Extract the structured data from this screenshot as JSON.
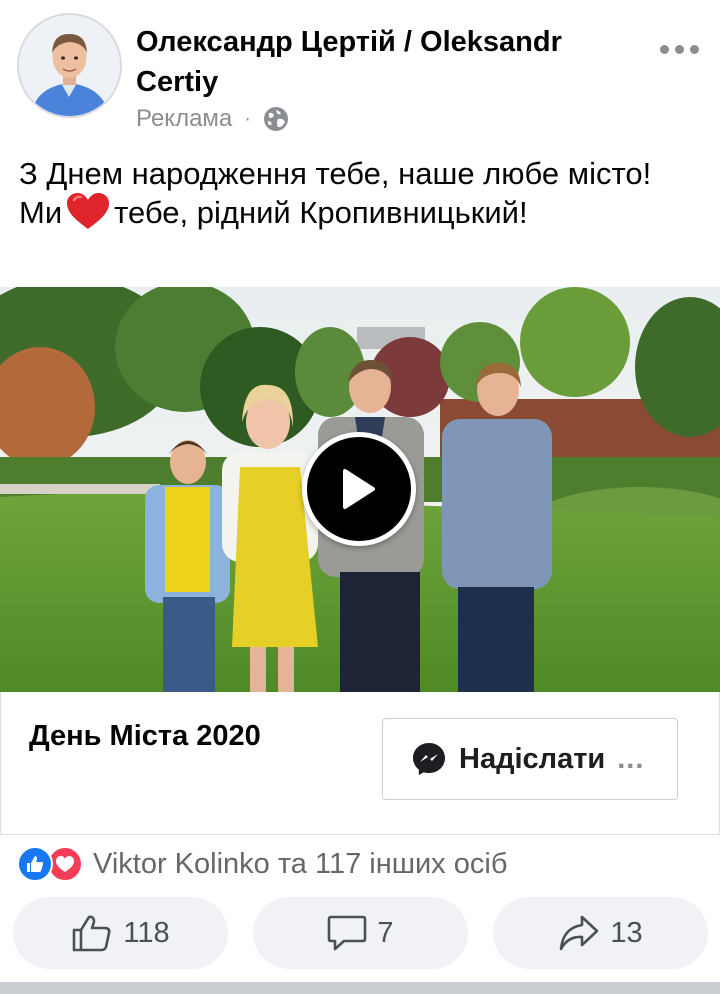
{
  "post": {
    "author": "Олександр Цертій / Oleksandr Certiy",
    "sponsored_label": "Реклама",
    "separator": "·",
    "audience_icon": "globe-icon",
    "more_icon": "more-options-icon",
    "text_line1": "З Днем народження тебе, наше любе місто!",
    "text_line2_before": "Ми",
    "text_line2_emoji": "red-heart",
    "text_line2_after": "тебе, рідний Кропивницький!"
  },
  "media": {
    "type": "video",
    "play_icon": "play-icon"
  },
  "cta": {
    "title": "День Міста 2020",
    "button_label": "Надіслати",
    "button_ellipsis": "...",
    "button_icon": "messenger-icon"
  },
  "reactions": {
    "icons": [
      "like-reaction-icon",
      "love-reaction-icon"
    ],
    "summary": "Viktor Kolinko та 117 інших осіб"
  },
  "actions": {
    "like_count": "118",
    "comment_count": "7",
    "share_count": "13"
  },
  "colors": {
    "like_blue": "#1877f2",
    "love_red": "#f33e58",
    "text_primary": "#050505",
    "text_secondary": "#65676b",
    "button_bg": "#f0f2f5"
  }
}
